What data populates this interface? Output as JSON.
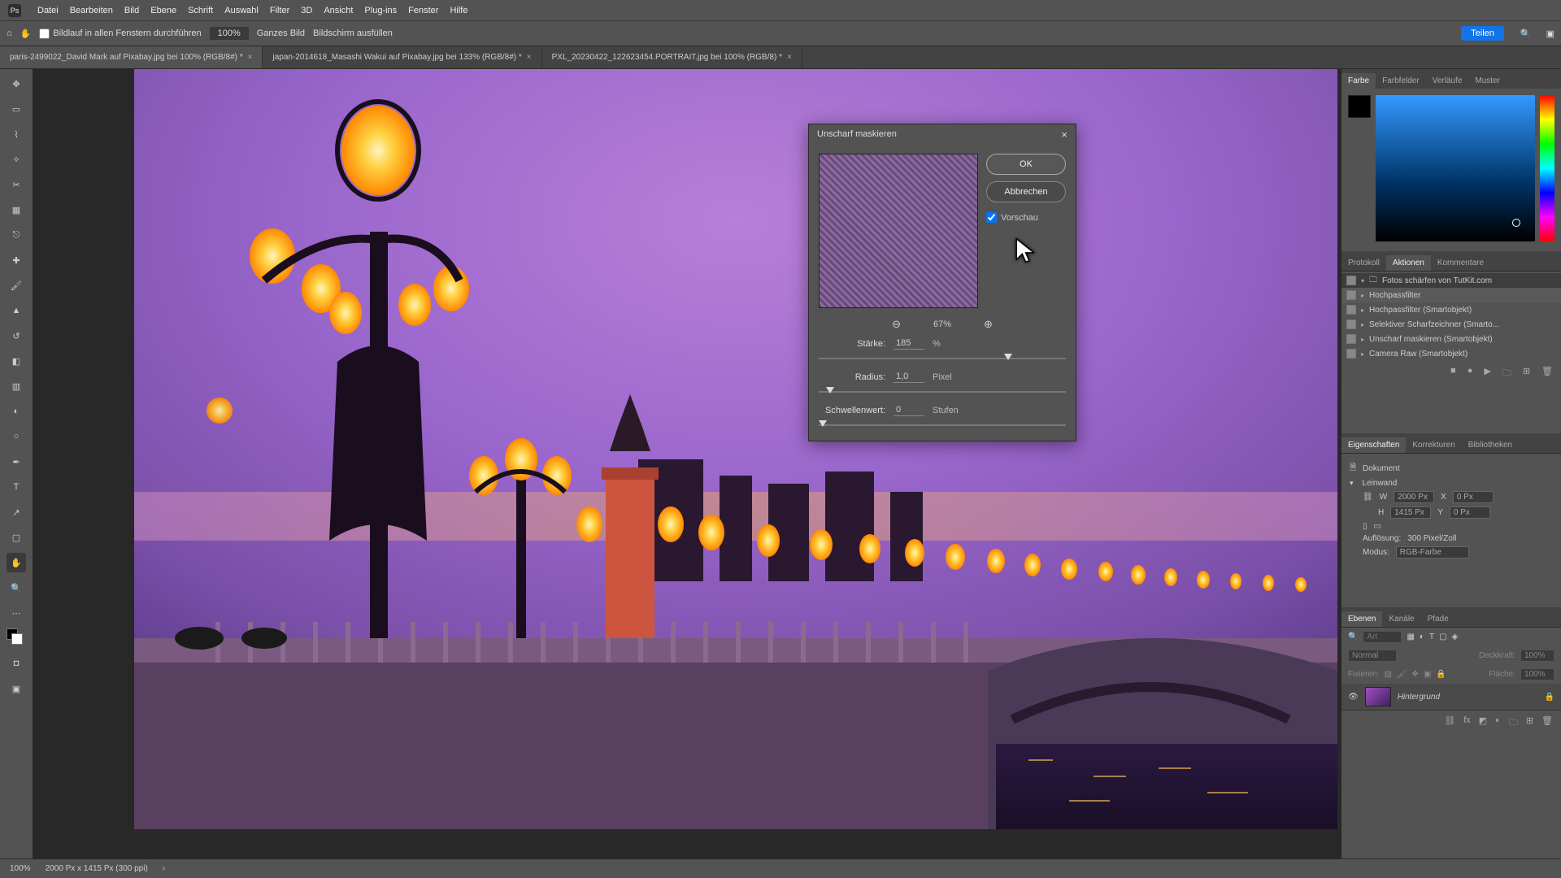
{
  "menu": {
    "items": [
      "Datei",
      "Bearbeiten",
      "Bild",
      "Ebene",
      "Schrift",
      "Auswahl",
      "Filter",
      "3D",
      "Ansicht",
      "Plug-ins",
      "Fenster",
      "Hilfe"
    ],
    "app_abbr": "Ps"
  },
  "options": {
    "scroll_label": "Bildlauf in allen Fenstern durchführen",
    "zoom_value": "100%",
    "fit_label": "Ganzes Bild",
    "fill_label": "Bildschirm ausfüllen",
    "share_label": "Teilen"
  },
  "tabs": [
    {
      "label": "paris-2499022_David Mark auf Pixabay.jpg bei 100% (RGB/8#) *",
      "active": true
    },
    {
      "label": "japan-2014618_Masashi Wakui auf Pixabay.jpg bei 133% (RGB/8#) *",
      "active": false
    },
    {
      "label": "PXL_20230422_122623454.PORTRAIT.jpg bei 100% (RGB/8) *",
      "active": false
    }
  ],
  "dialog": {
    "title": "Unscharf maskieren",
    "ok": "OK",
    "cancel": "Abbrechen",
    "preview": "Vorschau",
    "preview_checked": true,
    "zoom": "67%",
    "strength_label": "Stärke:",
    "strength_value": "185",
    "strength_unit": "%",
    "radius_label": "Radius:",
    "radius_value": "1,0",
    "radius_unit": "Pixel",
    "threshold_label": "Schwellenwert:",
    "threshold_value": "0",
    "threshold_unit": "Stufen"
  },
  "panels_tabs_color": [
    "Farbe",
    "Farbfelder",
    "Verläufe",
    "Muster"
  ],
  "panels_tabs_actions": [
    "Protokoll",
    "Aktionen",
    "Kommentare"
  ],
  "actions": {
    "group": "Fotos schärfen von TutKit.com",
    "items": [
      "Hochpassfilter",
      "Hochpassfilter (Smartobjekt)",
      "Selektiver Scharfzeichner (Smarto...",
      "Unscharf maskieren (Smartobjekt)",
      "Camera Raw (Smartobjekt)"
    ]
  },
  "panels_tabs_props": [
    "Eigenschaften",
    "Korrekturen",
    "Bibliotheken"
  ],
  "props": {
    "doc_label": "Dokument",
    "canvas_label": "Leinwand",
    "w_label": "W",
    "w_value": "2000 Px",
    "h_label": "H",
    "h_value": "1415 Px",
    "x_label": "X",
    "x_value": "0 Px",
    "y_label": "Y",
    "y_value": "0 Px",
    "res_label": "Auflösung:",
    "res_value": "300 Pixel/Zoll",
    "mode_label": "Modus:",
    "mode_value": "RGB-Farbe"
  },
  "panels_tabs_layers": [
    "Ebenen",
    "Kanäle",
    "Pfade"
  ],
  "layers": {
    "search_placeholder": "Art",
    "blend_mode": "Normal",
    "opacity_label": "Deckkraft:",
    "opacity_value": "100%",
    "lock_label": "Fixieren:",
    "fill_label": "Fläche:",
    "fill_value": "100%",
    "layer_name": "Hintergrund"
  },
  "status": {
    "zoom": "100%",
    "doc": "2000 Px x 1415 Px (300 ppi)"
  }
}
